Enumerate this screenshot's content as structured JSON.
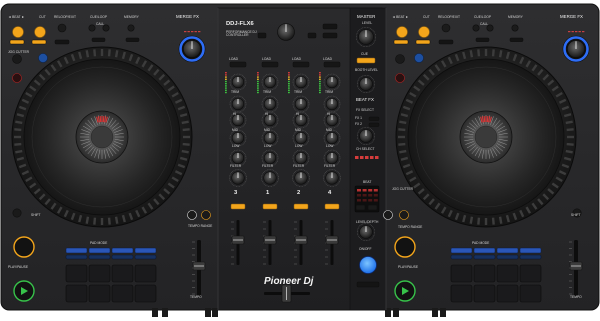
{
  "model": "DDJ-FLX6",
  "model_sub": "PERFORMANCE DJ CONTROLLER",
  "brand": "Pioneer Dj",
  "left_deck": {
    "beat_fx_lbl": "◄ BEAT ►",
    "cut_lbl": "CUT",
    "reloop_lbl": "RELOOP/EXIT",
    "cue_loop_lbl": "CUE/LOOP",
    "call_lbl": "CALL",
    "memory_lbl": "MEMORY",
    "merge_fx_lbl": "MERGE FX",
    "jog_cutter_lbl": "JOG CUTTER",
    "shift_lbl": "SHIFT",
    "play_pause_lbl": "PLAY/PAUSE",
    "tempo_lbl": "TEMPO",
    "tempo_range_lbl": "TEMPO RANGE",
    "pad_mode_lbl": "PAD MODE",
    "pad_modes": [
      "HOT CUE",
      "PAD FX1",
      "BEAT JUMP",
      "SAMPLER"
    ],
    "pad_modes2": [
      "KEYBOARD",
      "PAD FX2",
      "BEAT LOOP",
      "KEY SHIFT"
    ],
    "small_button_lbls": [
      "IN ADJUST",
      "OUT ADJUST",
      "ACTIVE LOOP"
    ]
  },
  "right_deck": {
    "beat_fx_lbl": "◄ BEAT ►",
    "cut_lbl": "CUT",
    "reloop_lbl": "RELOOP/EXIT",
    "cue_loop_lbl": "CUE/LOOP",
    "call_lbl": "CALL",
    "memory_lbl": "MEMORY",
    "merge_fx_lbl": "MERGE FX",
    "jog_cutter_lbl": "JOG CUTTER",
    "shift_lbl": "SHIFT",
    "play_pause_lbl": "PLAY/PAUSE",
    "tempo_lbl": "TEMPO",
    "tempo_range_lbl": "TEMPO RANGE",
    "pad_mode_lbl": "PAD MODE",
    "pad_modes": [
      "HOT CUE",
      "PAD FX1",
      "BEAT JUMP",
      "SAMPLER"
    ],
    "pad_modes2": [
      "KEYBOARD",
      "PAD FX2",
      "BEAT LOOP",
      "KEY SHIFT"
    ],
    "small_button_lbls": [
      "IN ADJUST",
      "OUT ADJUST",
      "ACTIVE LOOP"
    ]
  },
  "mixer": {
    "load_lbl": "LOAD",
    "trim_lbl": "TRIM",
    "hi_lbl": "HI",
    "mid_lbl": "MID",
    "low_lbl": "LOW",
    "filter_lbl": "FILTER",
    "cue_lbl": "CUE",
    "channel_numbers": [
      "3",
      "1",
      "2",
      "4"
    ],
    "master_lbl": "MASTER",
    "level_lbl": "LEVEL",
    "master_cue_lbl": "CUE",
    "booth_lbl": "BOOTH LEVEL",
    "beat_fx_lbl": "BEAT FX",
    "fx_select_lbl": "FX SELECT",
    "fx_ch_lbls": [
      "FX 1",
      "FX 2"
    ],
    "ch_select_lbl": "CH SELECT",
    "ch_select_vals": [
      "1",
      "2",
      "M",
      "3",
      "4"
    ],
    "beat_lbl": "BEAT",
    "level_depth_lbl": "LEVEL/DEPTH",
    "on_off_lbl": "ON/OFF",
    "release_lbl": "RELEASE FX",
    "browse_lbl": "BROWSE",
    "back_lbl": "BACK",
    "view_lbl": "VIEW",
    "phones_lbls": [
      "HEADPHONES",
      "MIXING",
      "LEVEL"
    ],
    "headphones_mix_lbl": "CUE MASTER",
    "smart_fader_lbl": "SMART CFX",
    "load_lbl2": "LOAD",
    "cfx_lbl": "SMART FADER",
    "mic_lbl": "MIC LEVEL"
  }
}
